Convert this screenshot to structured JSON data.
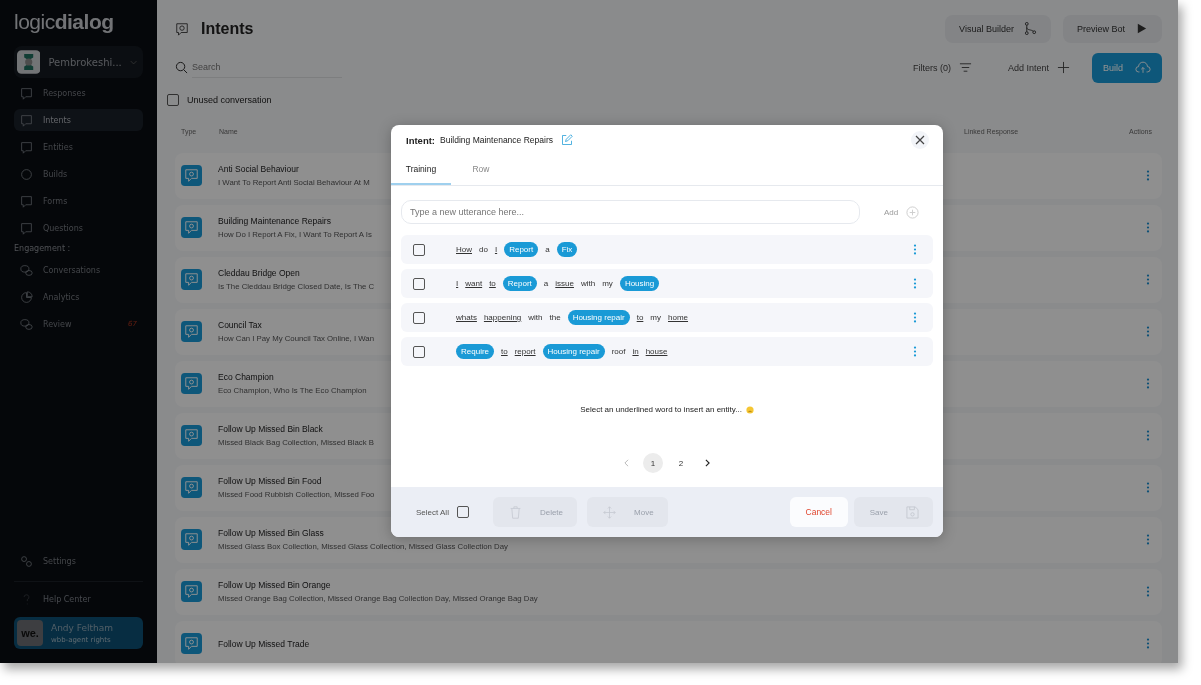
{
  "sidebar": {
    "logo": "logic**dialog**",
    "workspace": "Pembrokeshi...",
    "items": [
      {
        "label": "Responses",
        "selected": false
      },
      {
        "label": "Intents",
        "selected": true
      },
      {
        "label": "Entities",
        "selected": false
      },
      {
        "label": "Builds",
        "selected": false
      },
      {
        "label": "Forms",
        "selected": false
      },
      {
        "label": "Questions",
        "selected": false
      }
    ],
    "section_label": "Engagement :",
    "engagement_items": [
      {
        "label": "Conversations",
        "selected": false
      },
      {
        "label": "Analytics",
        "selected": false
      },
      {
        "label": "Review",
        "selected": false,
        "badge": "67"
      }
    ],
    "settings": "Settings",
    "help": "Help Center",
    "user": {
      "avatar_text": "we.",
      "name": "Andy Feltham",
      "role": "wbb-agent rights"
    }
  },
  "header": {
    "title": "Intents",
    "visual_builder": "Visual Builder",
    "preview_bot": "Preview Bot",
    "search_placeholder": "Search",
    "filters": "Filters (0)",
    "add_intent": "Add Intent",
    "build": "Build",
    "unused": {
      "label": "Unused conversation",
      "checked": false
    }
  },
  "table": {
    "columns": [
      "Type",
      "Name",
      "Linked Response",
      "Actions"
    ],
    "rows": [
      {
        "name": "Anti Social Behaviour",
        "description": "I Want To Report Anti Social Behaviour At M"
      },
      {
        "name": "Building Maintenance Repairs",
        "description": "How Do I Report A Fix, I Want To Report A Is"
      },
      {
        "name": "Cleddau Bridge Open",
        "description": "Is The Cleddau Bridge Closed Date, Is The C"
      },
      {
        "name": "Council Tax",
        "description": "How Can I Pay My Council Tax Online, I Wan"
      },
      {
        "name": "Eco Champion",
        "description": "Eco Champion, Who Is The Eco Champion"
      },
      {
        "name": "Follow Up Missed Bin Black",
        "description": "Missed Black Bag Collection, Missed Black B"
      },
      {
        "name": "Follow Up Missed Bin Food",
        "description": "Missed Food Rubbish Collection, Missed Foo"
      },
      {
        "name": "Follow Up Missed Bin Glass",
        "description": "Missed Glass Box Collection, Missed Glass Collection, Missed Glass Collection Day"
      },
      {
        "name": "Follow Up Missed Bin Orange",
        "description": "Missed Orange Bag Collection, Missed Orange Bag Collection Day, Missed Orange Bag Day"
      },
      {
        "name": "Follow Up Missed Trade"
      }
    ]
  },
  "modal": {
    "label": "Intent:",
    "name": "Building Maintenance Repairs",
    "tabs": [
      {
        "label": "Training",
        "selected": true
      },
      {
        "label": "Row",
        "selected": false
      }
    ],
    "utterance_placeholder": "Type a new utterance here...",
    "add": "Add",
    "utterances": [
      {
        "checked": false,
        "tokens": [
          {
            "text": "How",
            "kind": "word"
          },
          {
            "text": "do",
            "kind": "plain"
          },
          {
            "text": "I",
            "kind": "word"
          },
          {
            "text": "Report",
            "kind": "entity"
          },
          {
            "text": "a",
            "kind": "plain"
          },
          {
            "text": "Fix",
            "kind": "entity"
          }
        ]
      },
      {
        "checked": false,
        "tokens": [
          {
            "text": "I",
            "kind": "word"
          },
          {
            "text": "want",
            "kind": "word"
          },
          {
            "text": "to",
            "kind": "word"
          },
          {
            "text": "Report",
            "kind": "entity"
          },
          {
            "text": "a",
            "kind": "plain"
          },
          {
            "text": "issue",
            "kind": "word"
          },
          {
            "text": "with",
            "kind": "plain"
          },
          {
            "text": "my",
            "kind": "plain"
          },
          {
            "text": "Housing",
            "kind": "entity"
          }
        ]
      },
      {
        "checked": false,
        "tokens": [
          {
            "text": "whats",
            "kind": "word"
          },
          {
            "text": "happening",
            "kind": "word"
          },
          {
            "text": "with",
            "kind": "plain"
          },
          {
            "text": "the",
            "kind": "plain"
          },
          {
            "text": "Housing repair",
            "kind": "entity"
          },
          {
            "text": "to",
            "kind": "word"
          },
          {
            "text": "my",
            "kind": "plain"
          },
          {
            "text": "home",
            "kind": "word"
          }
        ]
      },
      {
        "checked": false,
        "tokens": [
          {
            "text": "Require",
            "kind": "entity"
          },
          {
            "text": "to",
            "kind": "word"
          },
          {
            "text": "report",
            "kind": "word"
          },
          {
            "text": "Housing repair",
            "kind": "entity"
          },
          {
            "text": "roof",
            "kind": "plain"
          },
          {
            "text": "in",
            "kind": "word"
          },
          {
            "text": "house",
            "kind": "word"
          }
        ]
      }
    ],
    "hint": "Select an underlined word to insert an entity...",
    "pages": [
      {
        "label": "1",
        "selected": true
      },
      {
        "label": "2",
        "selected": false
      }
    ],
    "select_all": {
      "label": "Select All",
      "checked": false
    },
    "delete": {
      "label": "Delete",
      "disabled": true
    },
    "move": {
      "label": "Move",
      "disabled": true
    },
    "cancel": "Cancel",
    "save": {
      "label": "Save",
      "disabled": true
    }
  }
}
